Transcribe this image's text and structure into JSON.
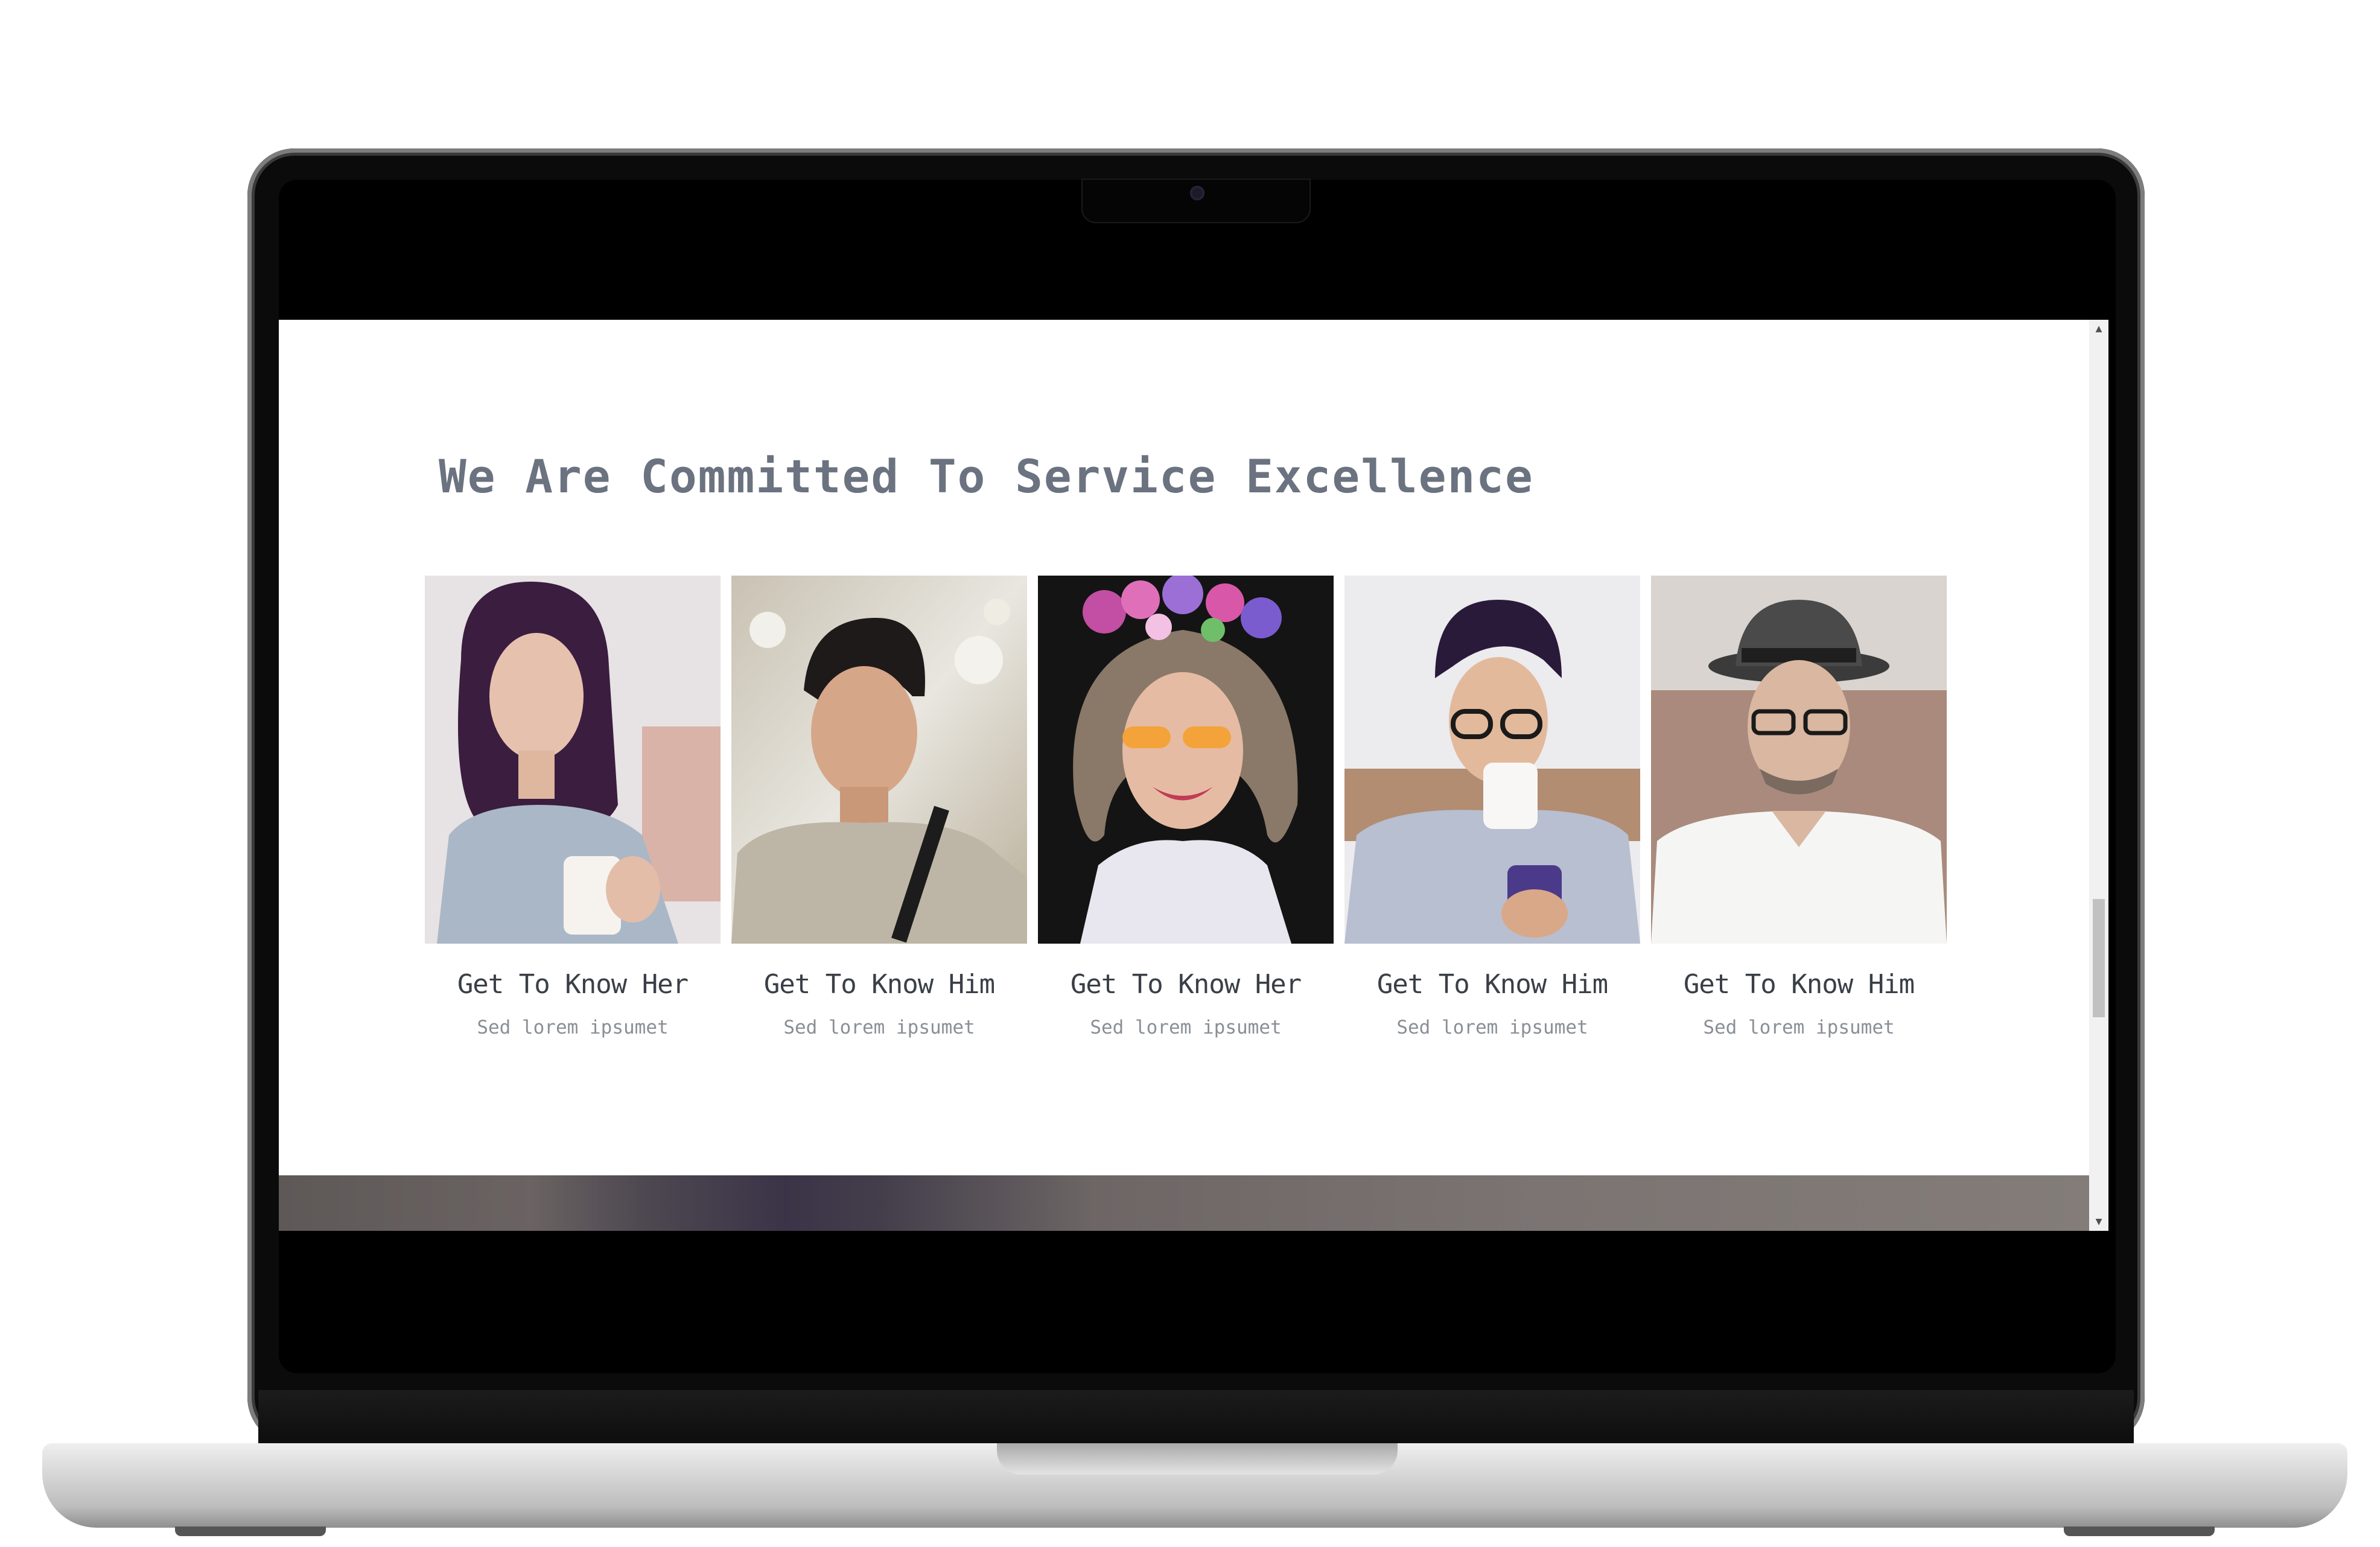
{
  "page": {
    "title": "We Are Committed To Service Excellence"
  },
  "cards": [
    {
      "title": "Get To Know Her",
      "subtitle": "Sed lorem ipsumet",
      "photo": "woman-with-mug-photo"
    },
    {
      "title": "Get To Know Him",
      "subtitle": "Sed lorem ipsumet",
      "photo": "smiling-man-photo"
    },
    {
      "title": "Get To Know Her",
      "subtitle": "Sed lorem ipsumet",
      "photo": "woman-flower-crown-photo"
    },
    {
      "title": "Get To Know Him",
      "subtitle": "Sed lorem ipsumet",
      "photo": "man-headphones-coffee-photo"
    },
    {
      "title": "Get To Know Him",
      "subtitle": "Sed lorem ipsumet",
      "photo": "man-in-hat-photo"
    }
  ],
  "scrollbar": {
    "up_icon": "▲",
    "down_icon": "▼"
  }
}
